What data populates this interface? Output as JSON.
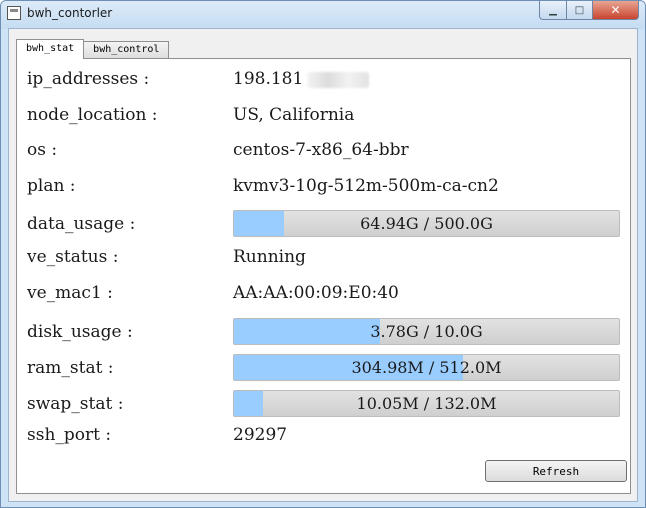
{
  "window": {
    "title": "bwh_contorler",
    "min_glyph": "▁",
    "max_glyph": "□",
    "close_glyph": "✕"
  },
  "tabs": [
    {
      "label": "bwh_stat",
      "active": true
    },
    {
      "label": "bwh_control",
      "active": false
    }
  ],
  "stats": {
    "ip_addresses": {
      "label": "ip_addresses :",
      "value": "198.181"
    },
    "node_location": {
      "label": "node_location :",
      "value": "US, California"
    },
    "os": {
      "label": "os :",
      "value": "centos-7-x86_64-bbr"
    },
    "plan": {
      "label": "plan :",
      "value": "kvmv3-10g-512m-500m-ca-cn2"
    },
    "data_usage": {
      "label": "data_usage :",
      "text": "64.94G / 500.0G",
      "fraction": 0.13
    },
    "ve_status": {
      "label": "ve_status :",
      "value": "Running"
    },
    "ve_mac1": {
      "label": "ve_mac1 :",
      "value": "AA:AA:00:09:E0:40"
    },
    "disk_usage": {
      "label": "disk_usage :",
      "text": "3.78G / 10.0G",
      "fraction": 0.378
    },
    "ram_stat": {
      "label": "ram_stat :",
      "text": "304.98M / 512.0M",
      "fraction": 0.596
    },
    "swap_stat": {
      "label": "swap_stat :",
      "text": "10.05M / 132.0M",
      "fraction": 0.076
    },
    "ssh_port": {
      "label": "ssh_port :",
      "value": "29297"
    }
  },
  "refresh_label": "Refresh",
  "colors": {
    "progress_fill": "#99ccff",
    "progress_track": "#d9d9d9",
    "close_button": "#c9452f"
  }
}
